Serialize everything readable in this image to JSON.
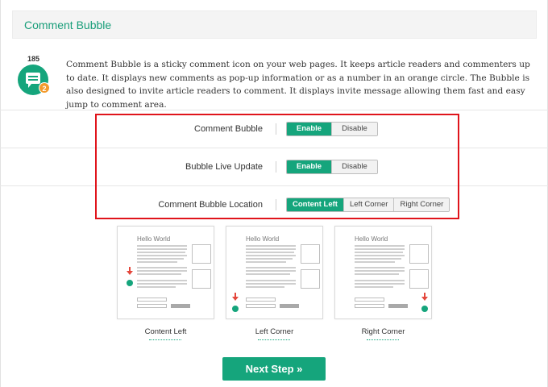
{
  "header": {
    "title": "Comment Bubble"
  },
  "intro": {
    "count": "185",
    "badge": "2",
    "text": "Comment Bubble is a sticky comment icon on your web pages. It keeps article readers and commenters up to date. It displays new comments as pop-up information or as a number in an orange circle. The Bubble is also designed to invite article readers to comment. It displays invite message allowing them fast and easy jump to comment area."
  },
  "settings": [
    {
      "label": "Comment Bubble",
      "options": [
        "Enable",
        "Disable"
      ],
      "selected": "Enable"
    },
    {
      "label": "Bubble Live Update",
      "options": [
        "Enable",
        "Disable"
      ],
      "selected": "Enable"
    },
    {
      "label": "Comment Bubble Location",
      "options": [
        "Content Left",
        "Left Corner",
        "Right Corner"
      ],
      "selected": "Content Left"
    }
  ],
  "previews": [
    {
      "title": "Hello World",
      "caption": "Content Left"
    },
    {
      "title": "Hello World",
      "caption": "Left Corner"
    },
    {
      "title": "Hello World",
      "caption": "Right Corner"
    }
  ],
  "actions": {
    "next_step": "Next Step »"
  },
  "colors": {
    "accent": "#15a57c",
    "badge": "#f39a2c",
    "highlight": "#e0141b",
    "arrow": "#e4473c"
  }
}
